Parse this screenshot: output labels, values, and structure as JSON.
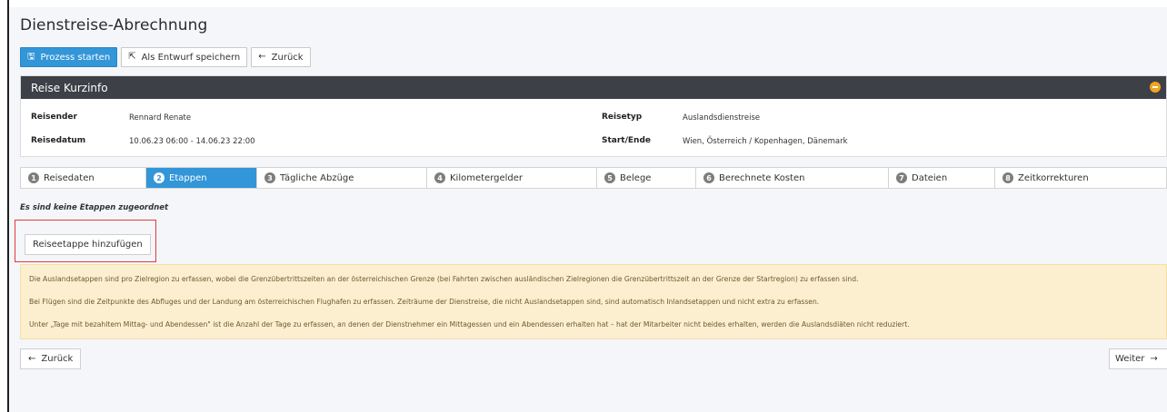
{
  "title": "Dienstreise-Abrechnung",
  "toolbar": {
    "start_label": "Prozess starten",
    "draft_label": "Als Entwurf speichern",
    "back_label": "Zurück"
  },
  "panel": {
    "title": "Reise Kurzinfo",
    "reisender_label": "Reisender",
    "reisender_value": "Rennard Renate",
    "reisedatum_label": "Reisedatum",
    "reisedatum_value": "10.06.23 06:00 - 14.06.23 22:00",
    "reisetyp_label": "Reisetyp",
    "reisetyp_value": "Auslandsdienstreise",
    "startende_label": "Start/Ende",
    "startende_value": "Wien, Österreich / Kopenhagen, Dänemark"
  },
  "steps": [
    {
      "num": "1",
      "label": "Reisedaten"
    },
    {
      "num": "2",
      "label": "Etappen"
    },
    {
      "num": "3",
      "label": "Tägliche Abzüge"
    },
    {
      "num": "4",
      "label": "Kilometergelder"
    },
    {
      "num": "5",
      "label": "Belege"
    },
    {
      "num": "6",
      "label": "Berechnete Kosten"
    },
    {
      "num": "7",
      "label": "Dateien"
    },
    {
      "num": "8",
      "label": "Zeitkorrekturen"
    }
  ],
  "active_step": 2,
  "empty_note": "Es sind keine Etappen zugeordnet",
  "add_button": "Reiseetappe hinzufügen",
  "info": [
    "Die Auslandsetappen sind pro Zielregion zu erfassen, wobei die Grenzübertrittszeiten an der österreichischen Grenze (bei Fahrten zwischen ausländischen Zielregionen die Grenzübertrittszeit an der Grenze der Startregion) zu erfassen sind.",
    "Bei Flügen sind die Zeitpunkte des Abfluges und der Landung am österreichischen Flughafen zu erfassen. Zeiträume der Dienstreise, die nicht Auslandsetappen sind, sind automatisch Inlandsetappen und nicht extra zu erfassen.",
    "Unter „Tage mit bezahltem Mittag- und Abendessen\" ist die Anzahl der Tage zu erfassen, an denen der Dienstnehmer ein Mittagessen und ein Abendessen erhalten hat – hat der Mitarbeiter nicht beides erhalten, werden die Auslandsdiäten nicht reduziert."
  ],
  "nav": {
    "back_label": "Zurück",
    "next_label": "Weiter"
  },
  "colors": {
    "primary": "#3296d8",
    "panel_header": "#3d4046",
    "info_bg": "#fcefcf",
    "highlight": "#e23a3a",
    "toggle": "#f3a31d"
  }
}
